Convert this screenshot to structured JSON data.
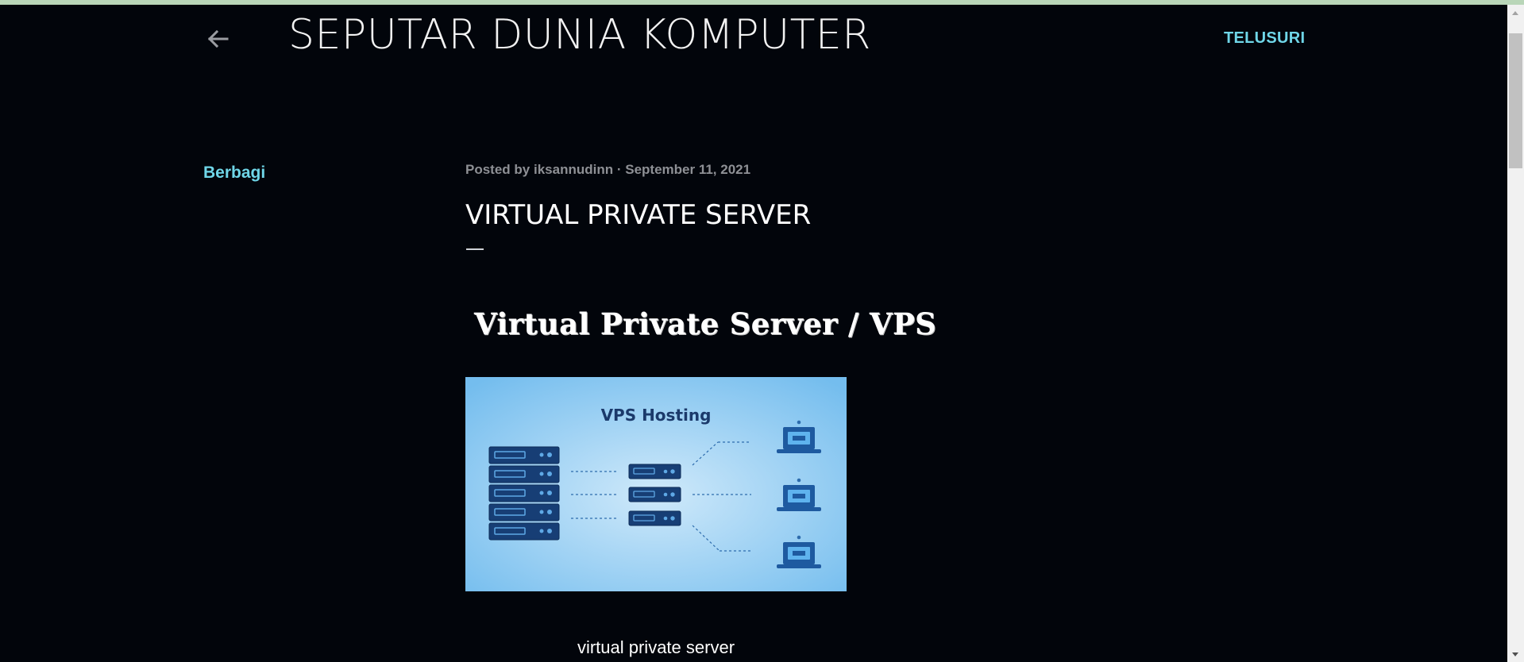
{
  "header": {
    "site_title": "SEPUTAR DUNIA KOMPUTER",
    "search_label": "TELUSURI"
  },
  "sidebar": {
    "share_label": "Berbagi"
  },
  "post": {
    "posted_by_prefix": "Posted by",
    "author": "iksannudinn",
    "separator": "·",
    "date": "September 11, 2021",
    "title": "VIRTUAL PRIVATE SERVER",
    "heading": "Virtual Private Server / VPS",
    "image": {
      "title": "VPS Hosting",
      "alt": "VPS hosting illustration"
    },
    "caption": "virtual private server"
  },
  "colors": {
    "background": "#02050b",
    "accent": "#6fd6e8",
    "meta_text": "#8e9095",
    "image_background": "#7cc4ee",
    "illustration_navy": "#163f76"
  },
  "icons": {
    "back": "arrow-left-icon"
  }
}
